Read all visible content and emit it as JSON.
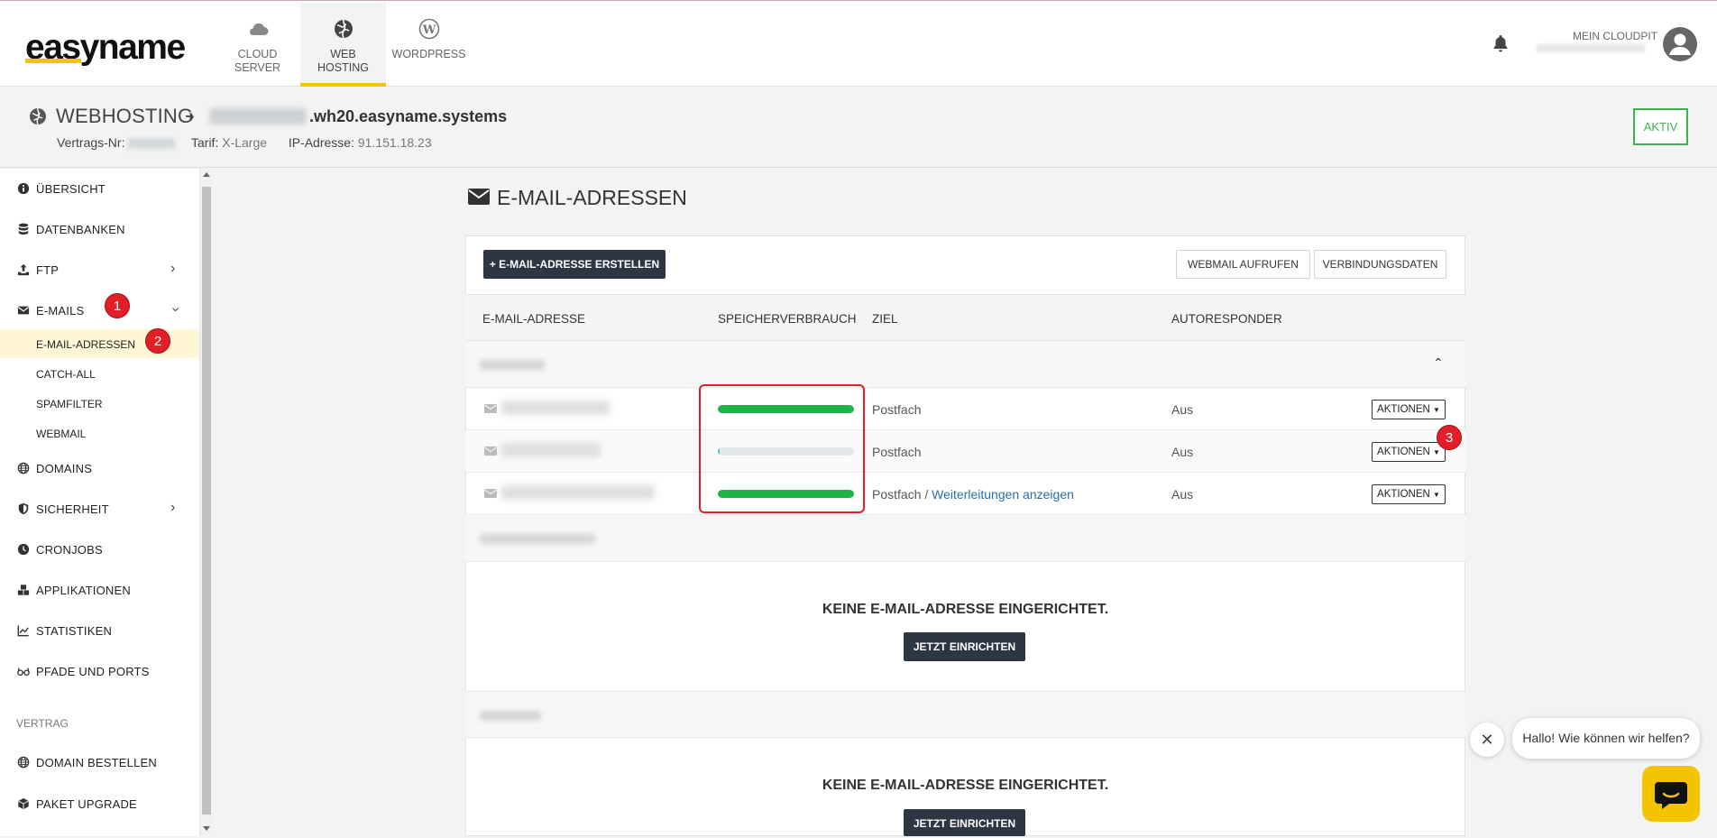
{
  "brand": {
    "logo_text": "easyname",
    "accent": "#f5c400"
  },
  "topnav": {
    "tabs": [
      {
        "label_line1": "CLOUD",
        "label_line2": "SERVER",
        "icon": "cloud-icon"
      },
      {
        "label_line1": "WEB",
        "label_line2": "HOSTING",
        "icon": "globe-icon"
      },
      {
        "label_line1": "WORDPRESS",
        "label_line2": "",
        "icon": "wordpress-icon"
      }
    ],
    "account_label": "MEIN CLOUDPIT"
  },
  "subheader": {
    "title": "WEBHOSTING",
    "host_suffix": ".wh20.easyname.systems",
    "contract_label": "Vertrags-Nr:",
    "tariff_label": "Tarif:",
    "tariff_value": "X-Large",
    "ip_label": "IP-Adresse:",
    "ip_value": "91.151.18.23",
    "status": "AKTIV",
    "status_color": "#3cb34a"
  },
  "sidebar": {
    "items": [
      {
        "label": "ÜBERSICHT",
        "icon": "info-icon"
      },
      {
        "label": "DATENBANKEN",
        "icon": "database-icon"
      },
      {
        "label": "FTP",
        "icon": "upload-icon"
      },
      {
        "label": "E-MAILS",
        "icon": "envelope-icon"
      },
      {
        "label": "DOMAINS",
        "icon": "globe-icon"
      },
      {
        "label": "SICHERHEIT",
        "icon": "shield-icon"
      },
      {
        "label": "CRONJOBS",
        "icon": "clock-icon"
      },
      {
        "label": "APPLIKATIONEN",
        "icon": "boxes-icon"
      },
      {
        "label": "STATISTIKEN",
        "icon": "chart-icon"
      },
      {
        "label": "PFADE UND PORTS",
        "icon": "glasses-icon"
      }
    ],
    "email_sub": [
      "E-MAIL-ADRESSEN",
      "CATCH-ALL",
      "SPAMFILTER",
      "WEBMAIL"
    ],
    "section_label": "VERTRAG",
    "contract_items": [
      {
        "label": "DOMAIN BESTELLEN",
        "icon": "globe-icon"
      },
      {
        "label": "PAKET UPGRADE",
        "icon": "cube-icon"
      }
    ]
  },
  "annotations": [
    "1",
    "2",
    "3"
  ],
  "main": {
    "title": "E-MAIL-ADRESSEN",
    "create_button": "+ E-MAIL-ADRESSE ERSTELLEN",
    "webmail_button": "WEBMAIL AUFRUFEN",
    "connection_button": "VERBINDUNGSDATEN",
    "columns": [
      "E-MAIL-ADRESSE",
      "SPEICHERVERBRAUCH",
      "ZIEL",
      "AUTORESPONDER"
    ],
    "rows": [
      {
        "usage": 1.0,
        "ziel": "Postfach",
        "link": "",
        "autoresponder": "Aus",
        "action": "AKTIONEN"
      },
      {
        "usage": 0.01,
        "ziel": "Postfach",
        "link": "",
        "autoresponder": "Aus",
        "action": "AKTIONEN"
      },
      {
        "usage": 1.0,
        "ziel": "Postfach / ",
        "link": "Weiterleitungen anzeigen",
        "autoresponder": "Aus",
        "action": "AKTIONEN"
      }
    ],
    "empty_text": "KEINE E-MAIL-ADRESSE EINGERICHTET.",
    "setup_button": "JETZT EINRICHTEN",
    "usage_color": "#1fb345"
  },
  "chat": {
    "message": "Hallo! Wie können wir helfen?"
  }
}
